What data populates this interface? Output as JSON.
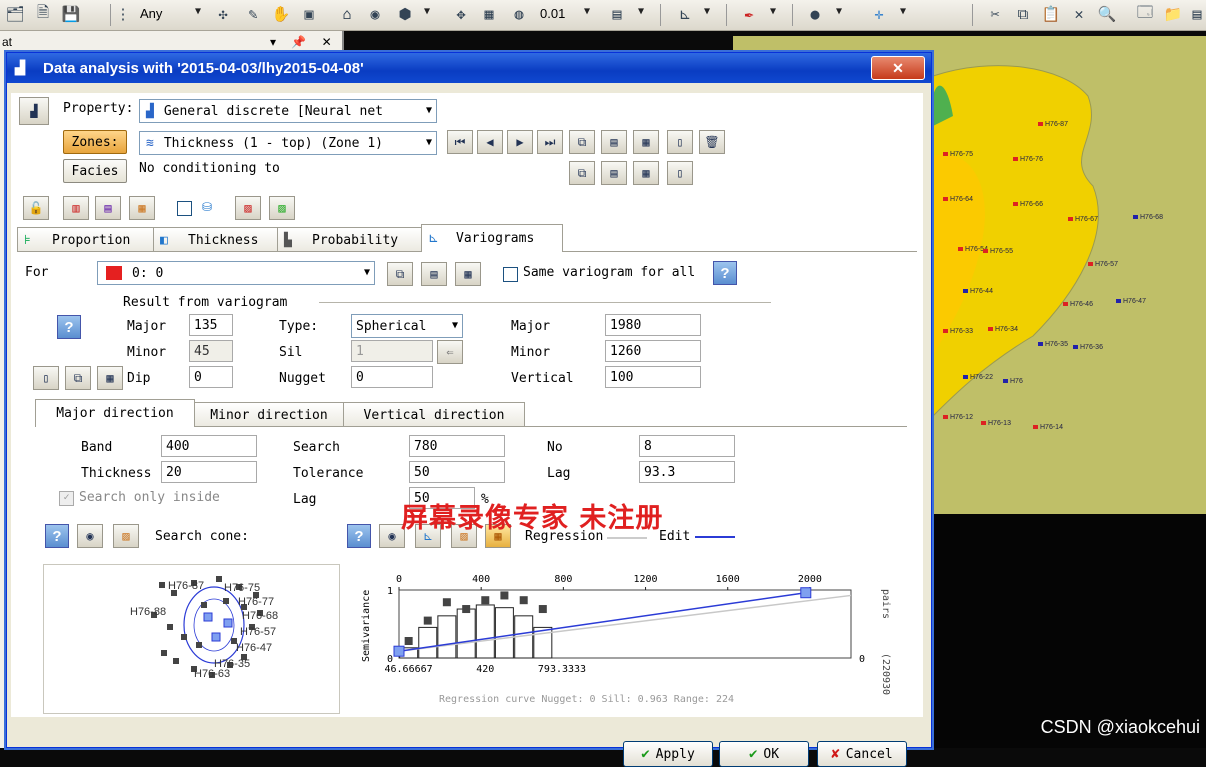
{
  "toolbar": {
    "filter_label": "Any",
    "step_value": "0.01",
    "icons": [
      "open-icon",
      "save-icon",
      "filter-icon",
      "home-icon",
      "eye-icon",
      "cube-icon",
      "move-icon",
      "globe-icon",
      "palette-icon",
      "axis-icon",
      "pen-icon",
      "sphere-icon",
      "crosshair-icon",
      "cut-icon",
      "copy-icon",
      "paste-icon",
      "delete-icon",
      "print-icon",
      "folder-icon"
    ]
  },
  "left_pane": {
    "header": "at",
    "pin_glyph": "▾ 📌 ✕"
  },
  "watermark_csdn": "CSDN @xiaokcehui",
  "dialog": {
    "title": "Data analysis with '2015-04-03/lhy2015-04-08'",
    "close_label": "✕",
    "property_label": "Property:",
    "property_value": "General discrete [Neural net",
    "zones_label": "Zones:",
    "zones_value": "Thickness (1 - top) (Zone 1)",
    "facies_label": "Facies",
    "facies_note": "No conditioning to",
    "tabs": [
      {
        "label": "Proportion"
      },
      {
        "label": "Thickness"
      },
      {
        "label": "Probability"
      },
      {
        "label": "Variograms"
      }
    ],
    "for_label": "For",
    "for_value": "0: 0",
    "same_variogram_label": "Same variogram for all",
    "result_group": "Result from variogram",
    "major_label": "Major",
    "major_value": "135",
    "minor_label": "Minor",
    "minor_value": "45",
    "dip_label": "Dip",
    "dip_value": "0",
    "type_label": "Type:",
    "type_value": "Spherical",
    "sill_label": "Sil",
    "sill_value": "1",
    "nugget_label": "Nugget",
    "nugget_value": "0",
    "range_major_label": "Major",
    "range_major_value": "1980",
    "range_minor_label": "Minor",
    "range_minor_value": "1260",
    "range_vertical_label": "Vertical",
    "range_vertical_value": "100",
    "subtabs": [
      {
        "label": "Major direction"
      },
      {
        "label": "Minor direction"
      },
      {
        "label": "Vertical direction"
      }
    ],
    "band_label": "Band",
    "band_value": "400",
    "thickness_label": "Thickness",
    "thickness_value": "20",
    "search_only_label": "Search only inside",
    "search_label": "Search",
    "search_value": "780",
    "tolerance_label": "Tolerance",
    "tolerance_value": "50",
    "lag_pct_label": "Lag",
    "lag_pct_value": "50",
    "pct_sign": "%",
    "no_label": "No",
    "no_value": "8",
    "lag_label": "Lag",
    "lag_value": "93.3",
    "search_cone_label": "Search cone:",
    "regression_label": "Regression",
    "edit_label": "Edit",
    "watermark": "屏幕录像专家   未注册",
    "buttons": {
      "apply": "Apply",
      "ok": "OK",
      "cancel": "Cancel"
    },
    "search_cone_wells": [
      "H76-87",
      "H76-75",
      "H76-77",
      "H76-68",
      "H76-57",
      "H76-47",
      "H76-35",
      "H76-63",
      "H76-88"
    ]
  },
  "chart_data": {
    "type": "scatter",
    "title": "",
    "xlabel": "",
    "ylabel": "Semivariance",
    "right_label": "pairs",
    "right_value_label": "(220930",
    "top_ticks": [
      "0",
      "400",
      "800",
      "1200",
      "1600",
      "2000"
    ],
    "bottom_ticks": [
      "46.66667",
      "420",
      "793.3333"
    ],
    "left_ticks": [
      "1",
      "0"
    ],
    "right_ticks": [
      "0"
    ],
    "xlim": [
      0,
      2200
    ],
    "ylim": [
      0,
      1
    ],
    "experimental_points": [
      {
        "x": 47,
        "y": 0.25
      },
      {
        "x": 140,
        "y": 0.55
      },
      {
        "x": 233,
        "y": 0.82
      },
      {
        "x": 327,
        "y": 0.72
      },
      {
        "x": 420,
        "y": 0.85
      },
      {
        "x": 513,
        "y": 0.92
      },
      {
        "x": 607,
        "y": 0.85
      },
      {
        "x": 700,
        "y": 0.72
      }
    ],
    "pair_bars": [
      {
        "x": 47,
        "h": 0.15
      },
      {
        "x": 140,
        "h": 0.45
      },
      {
        "x": 233,
        "h": 0.62
      },
      {
        "x": 327,
        "h": 0.72
      },
      {
        "x": 420,
        "h": 0.78
      },
      {
        "x": 513,
        "h": 0.74
      },
      {
        "x": 607,
        "h": 0.62
      },
      {
        "x": 700,
        "h": 0.45
      }
    ],
    "model_line": [
      [
        0,
        0.1
      ],
      [
        1980,
        0.96
      ]
    ],
    "handles": [
      {
        "x": 0,
        "y": 0.1
      },
      {
        "x": 1980,
        "y": 0.96
      }
    ],
    "footer": "Regression curve   Nugget: 0   Sill: 0.963   Range: 224"
  }
}
